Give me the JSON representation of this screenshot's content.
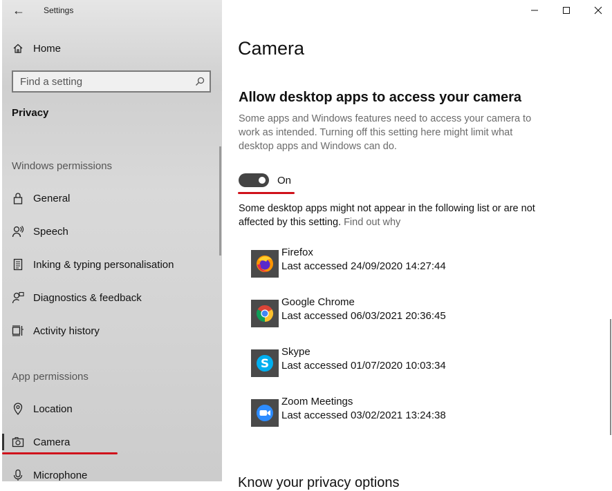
{
  "window": {
    "title": "Settings"
  },
  "sidebar": {
    "home_label": "Home",
    "search_placeholder": "Find a setting",
    "category": "Privacy",
    "windows_permissions_header": "Windows permissions",
    "windows_permissions": [
      {
        "label": "General",
        "icon": "lock-icon"
      },
      {
        "label": "Speech",
        "icon": "speech-icon"
      },
      {
        "label": "Inking & typing personalisation",
        "icon": "inking-icon"
      },
      {
        "label": "Diagnostics & feedback",
        "icon": "diagnostics-icon"
      },
      {
        "label": "Activity history",
        "icon": "activity-history-icon"
      }
    ],
    "app_permissions_header": "App permissions",
    "app_permissions": [
      {
        "label": "Location",
        "icon": "location-icon"
      },
      {
        "label": "Camera",
        "icon": "camera-icon",
        "selected": true
      },
      {
        "label": "Microphone",
        "icon": "microphone-icon"
      }
    ]
  },
  "main": {
    "title": "Camera",
    "section_title": "Allow desktop apps to access your camera",
    "description": "Some apps and Windows features need to access your camera to work as intended. Turning off this setting here might limit what desktop apps and Windows can do.",
    "toggle": {
      "state": "On",
      "on": true
    },
    "note": "Some desktop apps might not appear in the following list or are not affected by this setting.",
    "note_link": "Find out why",
    "apps": [
      {
        "name": "Firefox",
        "last_accessed": "Last accessed 24/09/2020 14:27:44",
        "icon": "firefox-icon"
      },
      {
        "name": "Google Chrome",
        "last_accessed": "Last accessed 06/03/2021 20:36:45",
        "icon": "chrome-icon"
      },
      {
        "name": "Skype",
        "last_accessed": "Last accessed 01/07/2020 10:03:34",
        "icon": "skype-icon"
      },
      {
        "name": "Zoom Meetings",
        "last_accessed": "Last accessed 03/02/2021 13:24:38",
        "icon": "zoom-icon"
      }
    ],
    "next_section_partial": "Know your privacy options"
  },
  "colors": {
    "highlight_underline": "#d0121b",
    "toggle_on": "#444444",
    "link": "#666666"
  }
}
